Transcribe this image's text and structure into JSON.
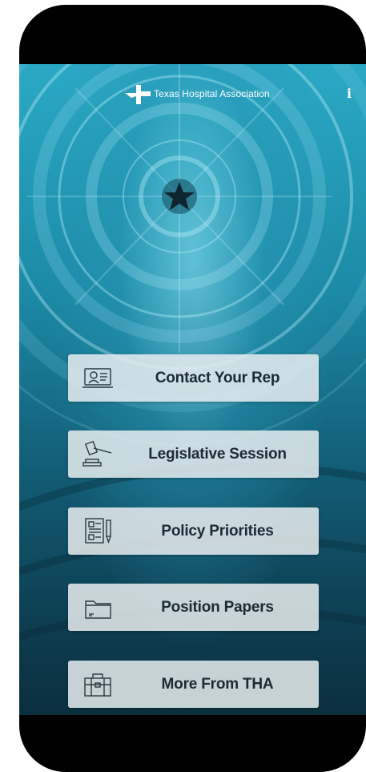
{
  "header": {
    "org_name": "Texas Hospital Association",
    "info_glyph": "i"
  },
  "menu": [
    {
      "label": "Contact Your Rep",
      "icon": "computer-user-icon"
    },
    {
      "label": "Legislative Session",
      "icon": "gavel-icon"
    },
    {
      "label": "Policy Priorities",
      "icon": "document-pen-icon"
    },
    {
      "label": "Position Papers",
      "icon": "folder-icon"
    },
    {
      "label": "More From THA",
      "icon": "briefcase-icon"
    }
  ],
  "colors": {
    "background_teal": "#1c8aa6",
    "button_bg": "#e6ecee",
    "button_text": "#1b2a33",
    "device_frame": "#000000"
  }
}
